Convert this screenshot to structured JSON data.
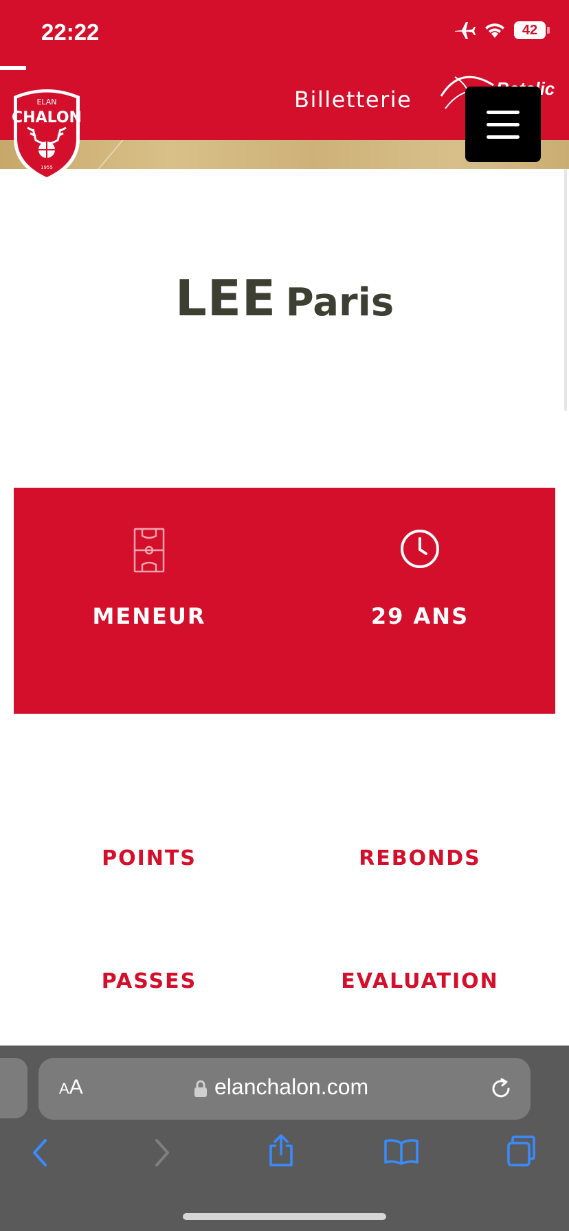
{
  "status": {
    "time": "22:22",
    "battery": "42",
    "icons": [
      "airplane-icon",
      "wifi-icon",
      "battery-icon"
    ]
  },
  "header": {
    "logo_lines": [
      "ELAN",
      "CHALON",
      "1955"
    ],
    "ticket_link": "Billetterie",
    "sponsor_text": "Betclic",
    "brand_color": "#d30f2c"
  },
  "player": {
    "last_name": "LEE",
    "first_name": "Paris"
  },
  "info": {
    "position": {
      "label": "MENEUR",
      "icon": "basketball-court-icon"
    },
    "age": {
      "label": "29 ANS",
      "icon": "clock-icon"
    }
  },
  "stats": [
    {
      "label": "POINTS"
    },
    {
      "label": "REBONDS"
    },
    {
      "label": "PASSES"
    },
    {
      "label": "EVALUATION"
    }
  ],
  "browser": {
    "text_size_small": "A",
    "text_size_big": "A",
    "url": "elanchalon.com",
    "toolbar_icons": [
      "back-icon",
      "forward-icon",
      "share-icon",
      "bookmarks-icon",
      "tabs-icon"
    ]
  }
}
